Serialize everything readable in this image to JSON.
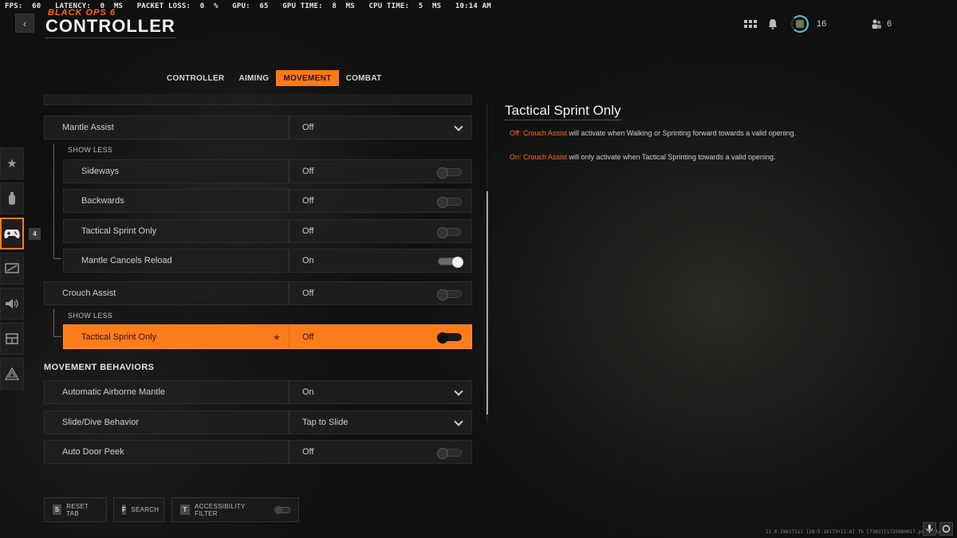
{
  "perf": {
    "fps_label": "FPS:",
    "fps": "60",
    "latency_label": "LATENCY:",
    "latency": "0",
    "latency_unit": "MS",
    "packet_label": "PACKET LOSS:",
    "packet": "0",
    "packet_unit": "%",
    "gpu_label": "GPU:",
    "gpu": "65",
    "gpu_time_label": "GPU TIME:",
    "gpu_time": "8",
    "gpu_time_unit": "MS",
    "cpu_time_label": "CPU TIME:",
    "cpu_time": "5",
    "cpu_time_unit": "MS",
    "clock": "10:14 AM"
  },
  "header": {
    "logo": "BLACK OPS 6",
    "title": "CONTROLLER",
    "rank_level": "16",
    "party_count": "6",
    "back_glyph": "‹"
  },
  "tabs": [
    {
      "label": "CONTROLLER",
      "active": false
    },
    {
      "label": "AIMING",
      "active": false
    },
    {
      "label": "MOVEMENT",
      "active": true
    },
    {
      "label": "COMBAT",
      "active": false
    }
  ],
  "rail": {
    "items": [
      "star-icon",
      "grenade-icon",
      "controller-icon",
      "display-icon",
      "speaker-icon",
      "interface-icon",
      "network-icon"
    ],
    "active_index": 2,
    "badge": "4"
  },
  "settings": {
    "mantle_assist": {
      "label": "Mantle Assist",
      "value": "Off"
    },
    "show_less_1": "SHOW LESS",
    "sideways": {
      "label": "Sideways",
      "value": "Off"
    },
    "backwards": {
      "label": "Backwards",
      "value": "Off"
    },
    "tactical_sprint_only_1": {
      "label": "Tactical Sprint Only",
      "value": "Off"
    },
    "mantle_cancels_reload": {
      "label": "Mantle Cancels Reload",
      "value": "On"
    },
    "crouch_assist": {
      "label": "Crouch Assist",
      "value": "Off"
    },
    "show_less_2": "SHOW LESS",
    "tactical_sprint_only_2": {
      "label": "Tactical Sprint Only",
      "value": "Off"
    },
    "section_movement_behaviors": "MOVEMENT BEHAVIORS",
    "automatic_airborne_mantle": {
      "label": "Automatic Airborne Mantle",
      "value": "On"
    },
    "slide_dive_behavior": {
      "label": "Slide/Dive Behavior",
      "value": "Tap to Slide"
    },
    "auto_door_peek": {
      "label": "Auto Door Peek",
      "value": "Off"
    }
  },
  "description": {
    "title": "Tactical Sprint Only",
    "line1_hl": "Off: Crouch Assist",
    "line1_rest": " will activate when Walking or Sprinting forward towards a valid opening.",
    "line2_hl": "On: Crouch Assist",
    "line2_rest": " will only activate when Tactical Sprinting towards a valid opening."
  },
  "footer": {
    "reset_key": "S",
    "reset_label": "RESET TAB",
    "search_key": "F",
    "search_label": "SEARCH",
    "access_key": "T",
    "access_label": "ACCESSIBILITY FILTER",
    "build": "11.0.19637111 [28:5:10173+11:A] Th [7303][1725080017.pc] [Steam]"
  },
  "colors": {
    "accent": "#ff7a14",
    "highlight_text": "#ff6a1f"
  }
}
